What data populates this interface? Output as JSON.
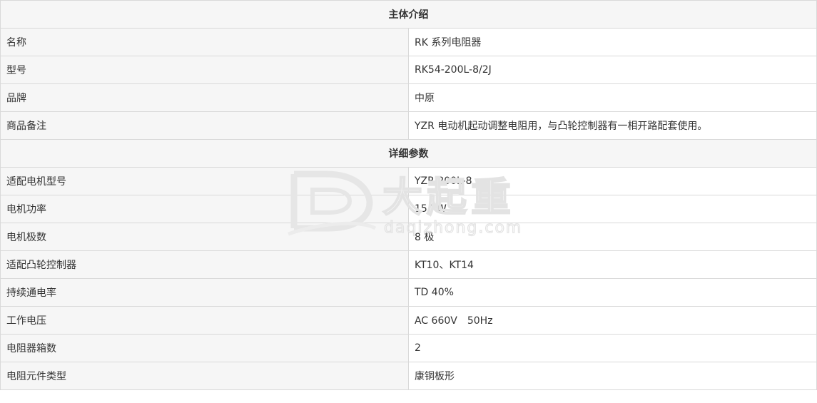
{
  "sections": [
    {
      "title": "主体介绍",
      "rows": [
        {
          "label": "名称",
          "value": "RK 系列电阻器"
        },
        {
          "label": "型号",
          "value": "RK54-200L-8/2J"
        },
        {
          "label": "品牌",
          "value": "中原"
        },
        {
          "label": "商品备注",
          "value": "YZR 电动机起动调整电阻用，与凸轮控制器有一相开路配套使用。"
        }
      ]
    },
    {
      "title": "详细参数",
      "rows": [
        {
          "label": "适配电机型号",
          "value": "YZR 200L-8"
        },
        {
          "label": "电机功率",
          "value": "15 KW"
        },
        {
          "label": "电机极数",
          "value": "8 极"
        },
        {
          "label": "适配凸轮控制器",
          "value": "KT10、KT14"
        },
        {
          "label": "持续通电率",
          "value": "TD 40%"
        },
        {
          "label": "工作电压",
          "value": "AC 660V　50Hz"
        },
        {
          "label": "电阻器箱数",
          "value": "2"
        },
        {
          "label": "电阻元件类型",
          "value": "康铜板形"
        }
      ]
    }
  ],
  "watermark": {
    "brand_cn": "大起重",
    "domain": "daqizhong.com"
  }
}
